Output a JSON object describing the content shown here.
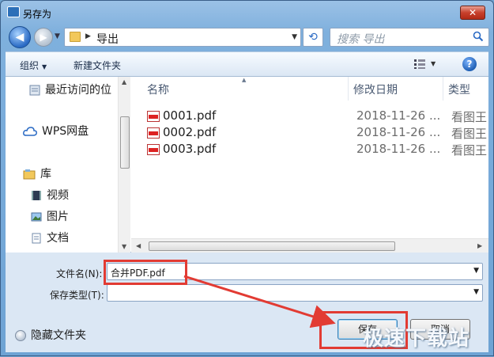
{
  "window": {
    "title": "另存为",
    "close_label": "✕"
  },
  "address": {
    "path": "导出",
    "search_placeholder": "搜索 导出"
  },
  "toolbar": {
    "organize": "组织",
    "new_folder": "新建文件夹"
  },
  "nav": {
    "items": [
      {
        "label": "最近访问的位",
        "icon": "recent-places-icon"
      },
      {
        "label": "WPS网盘",
        "icon": "cloud-icon"
      },
      {
        "label": "库",
        "icon": "library-icon"
      },
      {
        "label": "视频",
        "icon": "video-icon"
      },
      {
        "label": "图片",
        "icon": "picture-icon"
      },
      {
        "label": "文档",
        "icon": "document-icon"
      }
    ]
  },
  "files": {
    "columns": [
      "名称",
      "修改日期",
      "类型"
    ],
    "rows": [
      {
        "name": "0001.pdf",
        "date": "2018-11-26 ...",
        "type": "看图王"
      },
      {
        "name": "0002.pdf",
        "date": "2018-11-26 ...",
        "type": "看图王"
      },
      {
        "name": "0003.pdf",
        "date": "2018-11-26 ...",
        "type": "看图王"
      }
    ]
  },
  "form": {
    "filename_label": "文件名(N):",
    "filename_value": "合并PDF.pdf",
    "filetype_label": "保存类型(T):",
    "filetype_value": ""
  },
  "footer": {
    "hide_folders": "隐藏文件夹",
    "save_button": "保存",
    "cancel_button": "取消",
    "watermark": "极速下载站"
  },
  "colors": {
    "highlight_red": "#e23b33",
    "accent_blue": "#2a6ac4"
  }
}
